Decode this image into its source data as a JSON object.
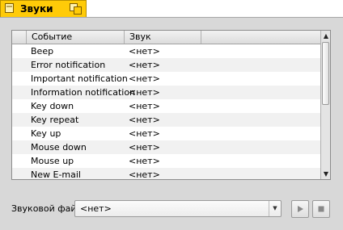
{
  "window": {
    "title": "Звуки"
  },
  "table": {
    "columns": [
      "Событие",
      "Звук"
    ],
    "rows": [
      {
        "event": "Beep",
        "sound": "<нет>"
      },
      {
        "event": "Error notification",
        "sound": "<нет>"
      },
      {
        "event": "Important notification",
        "sound": "<нет>"
      },
      {
        "event": "Information notification",
        "sound": "<нет>"
      },
      {
        "event": "Key down",
        "sound": "<нет>"
      },
      {
        "event": "Key repeat",
        "sound": "<нет>"
      },
      {
        "event": "Key up",
        "sound": "<нет>"
      },
      {
        "event": "Mouse down",
        "sound": "<нет>"
      },
      {
        "event": "Mouse up",
        "sound": "<нет>"
      },
      {
        "event": "New E-mail",
        "sound": "<нет>"
      }
    ]
  },
  "sound_file": {
    "label": "Звуковой файл:",
    "value": "<нет>"
  },
  "icons": {
    "play": "play-icon",
    "stop": "stop-icon",
    "window": "app-icon",
    "zoom": "zoom-icon"
  },
  "colors": {
    "tab": "#ffcb08",
    "panel": "#d8d8d8"
  }
}
